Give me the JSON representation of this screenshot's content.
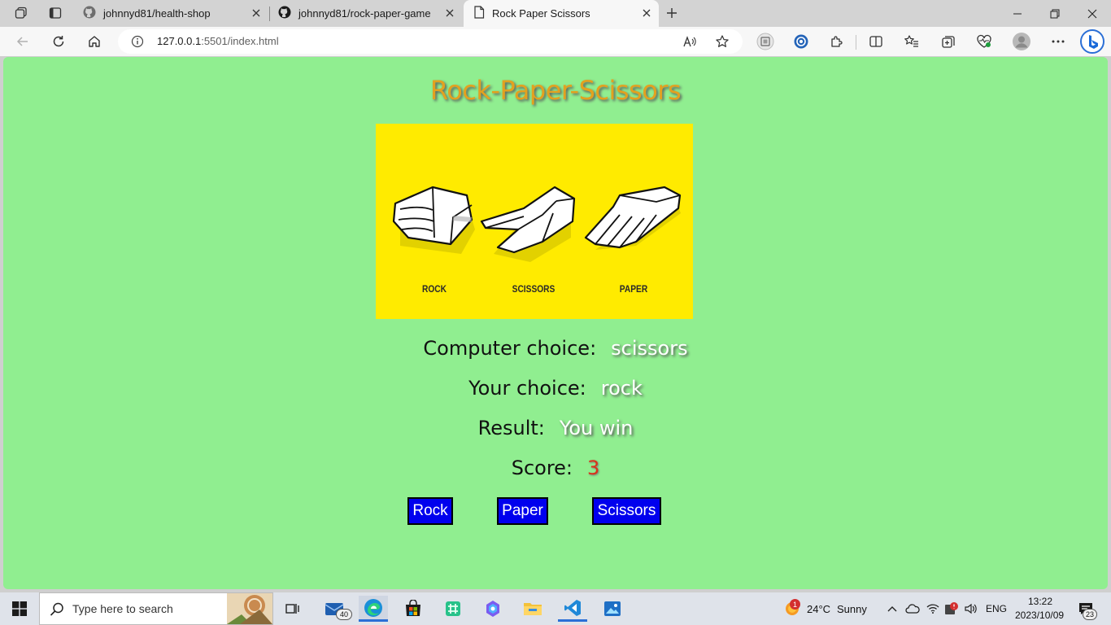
{
  "browser": {
    "tabs": [
      {
        "title": "johnnyd81/health-shop",
        "active": false
      },
      {
        "title": "johnnyd81/rock-paper-game",
        "active": false
      },
      {
        "title": "Rock Paper Scissors",
        "active": true
      }
    ],
    "address": {
      "host": "127.0.0.1",
      "rest": ":5501/index.html"
    }
  },
  "page": {
    "title": "Rock-Paper-Scissors",
    "image_labels": {
      "rock": "ROCK",
      "scissors": "SCISSORS",
      "paper": "PAPER"
    },
    "computer_choice_label": "Computer choice:",
    "computer_choice_value": "scissors",
    "your_choice_label": "Your choice:",
    "your_choice_value": "rock",
    "result_label": "Result:",
    "result_value": "You win",
    "score_label": "Score:",
    "score_value": "3",
    "buttons": {
      "rock": "Rock",
      "paper": "Paper",
      "scissors": "Scissors"
    },
    "colors": {
      "background": "#90ee90",
      "title": "#e3a11f",
      "button": "#0000ee",
      "score": "#d8321a",
      "image_bg": "#ffeb00"
    }
  },
  "taskbar": {
    "search_placeholder": "Type here to search",
    "mail_badge": "40",
    "weather_badge": "1",
    "weather_temp": "24°C",
    "weather_desc": "Sunny",
    "language": "ENG",
    "time": "13:22",
    "date": "2023/10/09",
    "notification_count": "23"
  }
}
